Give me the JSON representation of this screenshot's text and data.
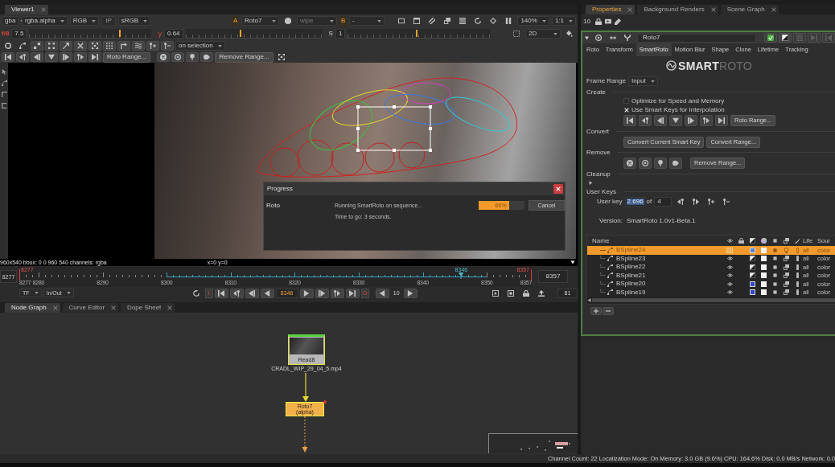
{
  "viewer": {
    "tab": {
      "label": "Viewer1",
      "selected": true
    },
    "toolbar": {
      "channels": "gba",
      "layer": "rgba.alpha",
      "display": "RGB",
      "ip": "IP",
      "lut": "sRGB",
      "input_a": {
        "letter": "A",
        "node": "Roto7"
      },
      "wipe": "wipe",
      "input_b": {
        "letter": "B",
        "node": "-"
      },
      "zoom": "140%",
      "proxy": "1:1"
    },
    "exposure": {
      "fstop": "f/8",
      "gain": "7.5",
      "gain_slider": {
        "level": 0.74
      },
      "gamma_symbol": "γ",
      "gamma": "0.64",
      "gamma_slider": {
        "level": 0.4
      },
      "saturation_label": "S",
      "saturation": "1",
      "saturation_slider": {
        "level": 0.48
      },
      "view_mode": "2D"
    },
    "roto_toolbar": {
      "scope": "on selection"
    },
    "key_toolbar": {
      "range_button": "Roto Range...",
      "remove_button": "Remove Range..."
    },
    "info": {
      "format": "960x540  bbox: 0 0 960 540 channels: rgba",
      "coords": "x=0 y=0"
    },
    "progress_dialog": {
      "title": "Progress",
      "task": "Roto",
      "message": "Running SmartRoto on sequence...",
      "eta": "Time to go: 3 seconds.",
      "level": 0.66,
      "percent": "66%",
      "cancel": "Cancel"
    }
  },
  "timeline": {
    "start": "8277",
    "end": "8357",
    "in_marker": "8277",
    "out_marker": "8357",
    "playhead": {
      "label": "8346",
      "level": 0.8625
    },
    "ticks": [
      "8277",
      "8280",
      "8290",
      "8300",
      "8310",
      "8320",
      "8330",
      "8340",
      "8350",
      "8357"
    ],
    "segments": [
      {
        "cached": false
      },
      {
        "cached": false
      },
      {
        "cached": false
      },
      {
        "cached": true
      },
      {
        "cached": true
      },
      {
        "cached": true
      },
      {
        "cached": true
      },
      {
        "cached": true
      },
      {
        "cached": false
      }
    ]
  },
  "playback": {
    "cache_mode": "TF",
    "range_mode": "In/Out",
    "in_button": "I",
    "frame": "8346",
    "out_button": "O",
    "increment": "10",
    "fps": "81"
  },
  "node_graph": {
    "tabs": [
      {
        "label": "Node Graph",
        "selected": true
      },
      {
        "label": "Curve Editor",
        "selected": false
      },
      {
        "label": "Dope Sheet",
        "selected": false
      }
    ],
    "nodes": [
      {
        "kind": "read",
        "label": "Read8",
        "file": "CRADL_WIP_29_04_5.mp4",
        "selected": true
      },
      {
        "kind": "roto",
        "label": "Roto7",
        "sublabel": "(alpha)",
        "selected": true
      }
    ]
  },
  "properties": {
    "tabs": [
      {
        "label": "Properties",
        "selected": true
      },
      {
        "label": "Background Renders",
        "selected": false
      },
      {
        "label": "Scene Graph",
        "selected": false
      }
    ],
    "max_panels": "10",
    "node": {
      "name": "Roto7",
      "tabs": [
        {
          "label": "Roto",
          "selected": false
        },
        {
          "label": "Transform",
          "selected": false
        },
        {
          "label": "SmartRoto",
          "selected": true
        },
        {
          "label": "Motion Blur",
          "selected": false
        },
        {
          "label": "Shape",
          "selected": false
        },
        {
          "label": "Clone",
          "selected": false
        },
        {
          "label": "Lifetime",
          "selected": false
        },
        {
          "label": "Tracking",
          "selected": false
        }
      ],
      "logo": "**SMART**ROTO",
      "frame_range": {
        "label": "Frame Range",
        "value": "Input"
      },
      "create": {
        "label": "Create",
        "options": [
          {
            "label": "Optimize for Speed and Memory",
            "checked": false
          },
          {
            "label": "Use Smart Keys for Interpolation",
            "checked": true
          }
        ],
        "range_button": "Roto Range..."
      },
      "convert": {
        "label": "Convert",
        "buttons": [
          "Convert Current Smart Key",
          "Convert Range..."
        ]
      },
      "remove": {
        "label": "Remove",
        "range_button": "Remove Range..."
      },
      "cleanup": {
        "label": "Cleanup",
        "expanded": false
      },
      "user_keys": {
        "label": "User Keys",
        "field_label": "User key",
        "value": "2.696",
        "value_highlighted": true,
        "of": "of",
        "total": "4"
      },
      "version": {
        "label": "Version:",
        "value": "SmartRoto 1.0v1-Beta.1"
      },
      "shapes": {
        "columns": {
          "name": "Name",
          "life": "Life",
          "source": "Sour"
        },
        "rows": [
          {
            "name": "BSpline24",
            "selected": true,
            "visible": false,
            "color": "#5b86cc",
            "life": "all",
            "source": "color"
          },
          {
            "name": "BSpline23",
            "selected": false,
            "visible": true,
            "life": "all",
            "source": "color"
          },
          {
            "name": "BSpline22",
            "selected": false,
            "visible": true,
            "life": "all",
            "source": "color"
          },
          {
            "name": "BSpline21",
            "selected": false,
            "visible": true,
            "life": "all",
            "source": "color"
          },
          {
            "name": "BSpline20",
            "selected": false,
            "visible": true,
            "color": "#2f48c4",
            "life": "all",
            "source": "color"
          },
          {
            "name": "BSpline19",
            "selected": false,
            "visible": true,
            "color": "#2f48c4",
            "life": "all",
            "source": "color"
          }
        ]
      }
    }
  },
  "status_bar": "Channel Count: 22  Localization Mode: On  Memory: 3.0 GB (9.6%) CPU: 164.6% Disk: 0.0 MB/s Network: 0.0"
}
